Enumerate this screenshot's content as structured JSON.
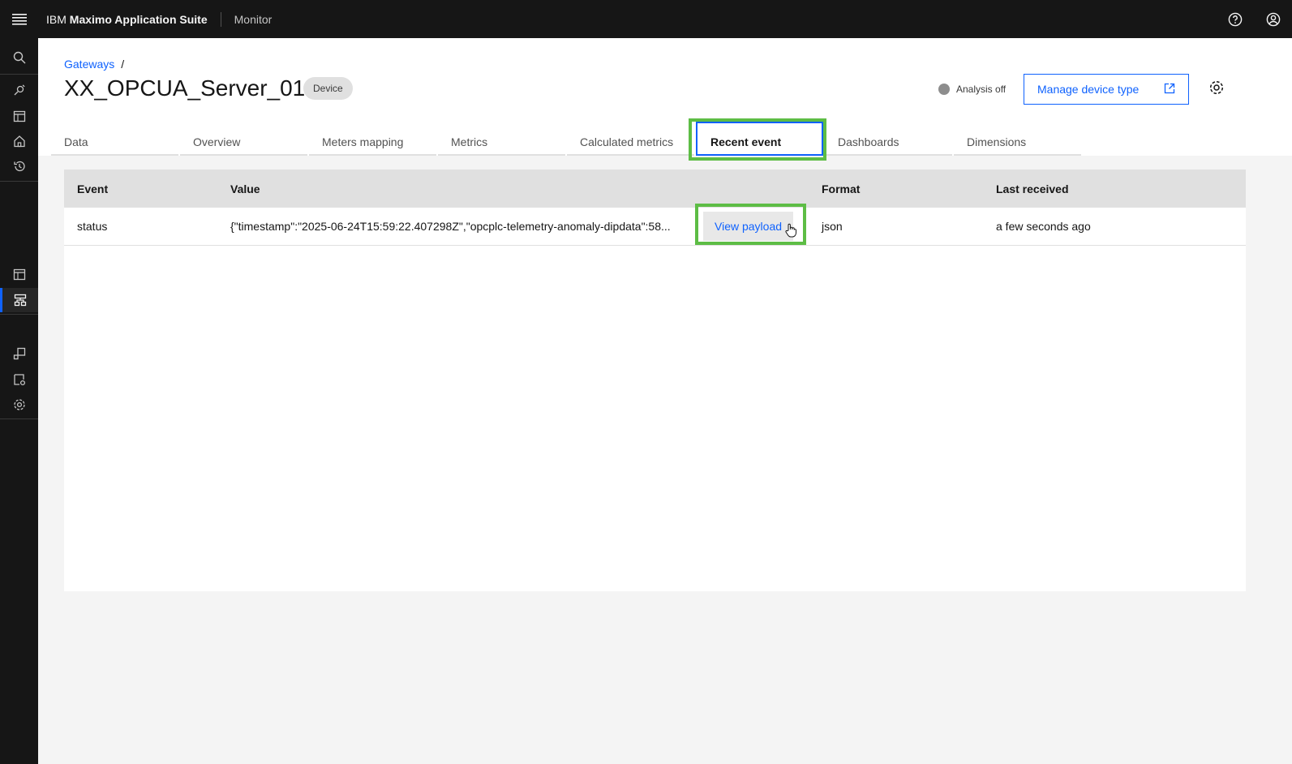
{
  "header": {
    "brand_prefix": "IBM",
    "brand_name": "Maximo Application Suite",
    "app_name": "Monitor"
  },
  "breadcrumb": {
    "link": "Gateways",
    "separator": "/"
  },
  "page": {
    "title": "XX_OPCUA_Server_01",
    "tag": "Device",
    "analysis_status": "Analysis off",
    "manage_button": "Manage device type"
  },
  "tabs": [
    {
      "label": "Data"
    },
    {
      "label": "Overview"
    },
    {
      "label": "Meters mapping"
    },
    {
      "label": "Metrics"
    },
    {
      "label": "Calculated metrics"
    },
    {
      "label": "Recent event"
    },
    {
      "label": "Dashboards"
    },
    {
      "label": "Dimensions"
    }
  ],
  "selected_tab": "Recent event",
  "table": {
    "headers": [
      "Event",
      "Value",
      "Format",
      "Last received"
    ],
    "rows": [
      {
        "event": "status",
        "value": "{\"timestamp\":\"2025-06-24T15:59:22.407298Z\",\"opcplc-telemetry-anomaly-dipdata\":58...",
        "action": "View payload",
        "format": "json",
        "last_received": "a few seconds ago"
      }
    ]
  },
  "colors": {
    "accent": "#0f62fe",
    "highlight": "#5dbd45",
    "header_bg": "#161616"
  }
}
